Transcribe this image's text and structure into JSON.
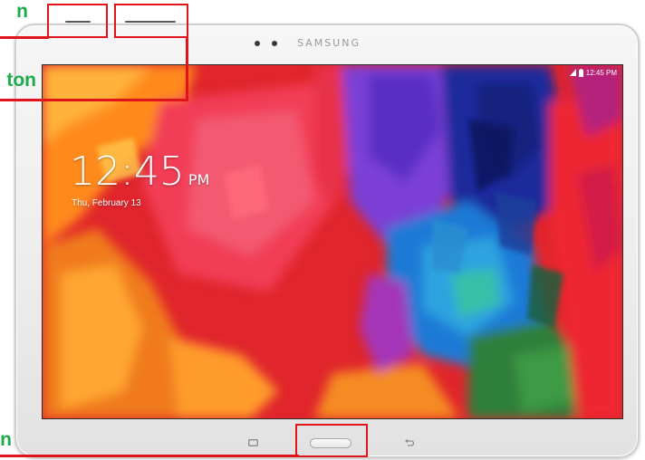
{
  "callout_labels": {
    "power_fragment": "n",
    "volume_fragment": "ton",
    "home_fragment": "n"
  },
  "device": {
    "brand": "SAMSUNG"
  },
  "status_bar": {
    "time": "12:45 PM"
  },
  "lock_screen": {
    "time": "12:45",
    "ampm": "PM",
    "date": "Thu, February 13"
  },
  "colors": {
    "callout_red": "#e1131b",
    "label_green": "#1bab49"
  }
}
